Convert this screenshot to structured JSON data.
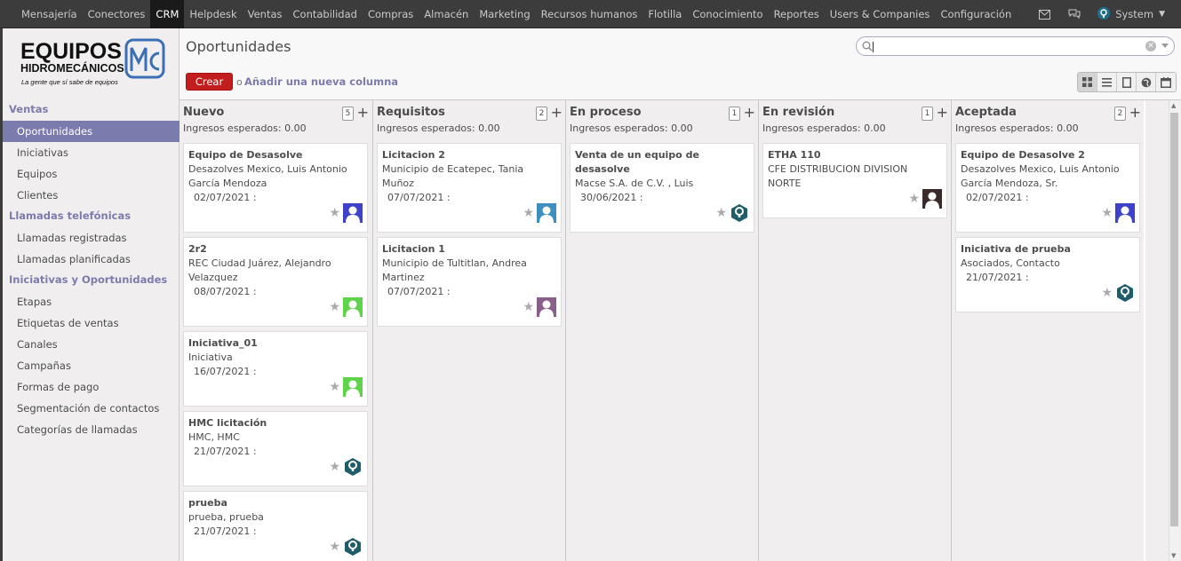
{
  "topbar": {
    "apps": [
      "Mensajería",
      "Conectores",
      "CRM",
      "Helpdesk",
      "Ventas",
      "Contabilidad",
      "Compras",
      "Almacén",
      "Marketing",
      "Recursos humanos",
      "Flotilla",
      "Conocimiento",
      "Reportes",
      "Users & Companies",
      "Configuración"
    ],
    "active_app": "CRM",
    "user": "System"
  },
  "logo": {
    "line1": "EQUIPOS",
    "line2": "HIDROMECÁNICOS",
    "tagline": "La gente que sí sabe de equipos",
    "mark": "MC"
  },
  "sidebar": {
    "sections": [
      {
        "title": "Ventas",
        "items": [
          "Oportunidades",
          "Iniciativas",
          "Equipos",
          "Clientes"
        ]
      },
      {
        "title": "Llamadas telefónicas",
        "items": [
          "Llamadas registradas",
          "Llamadas planificadas"
        ]
      },
      {
        "title": "Iniciativas y Oportunidades",
        "items": [
          "Etapas",
          "Etiquetas de ventas",
          "Canales",
          "Campañas",
          "Formas de pago",
          "Segmentación de contactos",
          "Categorías de llamadas"
        ]
      }
    ],
    "active_item": "Oportunidades"
  },
  "control_panel": {
    "title": "Oportunidades",
    "create_label": "Crear",
    "or_label": "o",
    "add_column_label": "Añadir una nueva columna",
    "search_value": ""
  },
  "kanban": {
    "expected_label": "Ingresos esperados: 0.00",
    "columns": [
      {
        "name": "Nuevo",
        "count": "5",
        "cards": [
          {
            "name": "Equipo de Desasolve",
            "lines": [
              "Desazolves Mexico, Luis Antonio",
              "García Mendoza"
            ],
            "date": "02/07/2021 :",
            "avatar": "blue-person"
          },
          {
            "name": "2r2",
            "lines": [
              "REC Ciudad Juárez, Alejandro",
              "Velazquez"
            ],
            "date": "08/07/2021 :",
            "avatar": "green-person"
          },
          {
            "name": "Iniciativa_01",
            "lines": [
              "Iniciativa"
            ],
            "date": "16/07/2021 :",
            "avatar": "green-person"
          },
          {
            "name": "HMC licitación",
            "lines": [
              "HMC, HMC"
            ],
            "date": "21/07/2021 :",
            "avatar": "odoo-bot"
          },
          {
            "name": "prueba",
            "lines": [
              "prueba, prueba"
            ],
            "date": "21/07/2021 :",
            "avatar": "odoo-bot"
          }
        ]
      },
      {
        "name": "Requisitos",
        "count": "2",
        "cards": [
          {
            "name": "Licitacion 2",
            "lines": [
              "Municipio de Ecatepec, Tania",
              "Muñoz"
            ],
            "date": "07/07/2021 :",
            "avatar": "teal-person"
          },
          {
            "name": "Licitacion 1",
            "lines": [
              "Municipio de Tultitlan, Andrea",
              "Martinez"
            ],
            "date": "07/07/2021 :",
            "avatar": "mauve-person"
          }
        ]
      },
      {
        "name": "En proceso",
        "count": "1",
        "cards": [
          {
            "name": "Venta de un equipo de",
            "name2": "desasolve",
            "lines": [
              "Macse S.A. de C.V. , Luis"
            ],
            "date": "30/06/2021 :",
            "avatar": "odoo-bot"
          }
        ]
      },
      {
        "name": "En revisión",
        "count": "1",
        "cards": [
          {
            "name": "ETHA 110",
            "lines": [
              "CFE DISTRIBUCION DIVISION",
              "NORTE"
            ],
            "date": "",
            "avatar": "dark-person"
          }
        ]
      },
      {
        "name": "Aceptada",
        "count": "2",
        "cards": [
          {
            "name": "Equipo de Desasolve 2",
            "lines": [
              "Desazolves Mexico, Luis Antonio",
              "García Mendoza, Sr."
            ],
            "date": "02/07/2021 :",
            "avatar": "blue-person"
          },
          {
            "name": "Iniciativa de prueba",
            "lines": [
              "Asociados, Contacto"
            ],
            "date": "21/07/2021 :",
            "avatar": "odoo-bot"
          }
        ]
      }
    ]
  },
  "colors": {
    "topbar": "#3c3c3c",
    "accent": "#7c7bad",
    "create_button": "#c31e1e"
  }
}
